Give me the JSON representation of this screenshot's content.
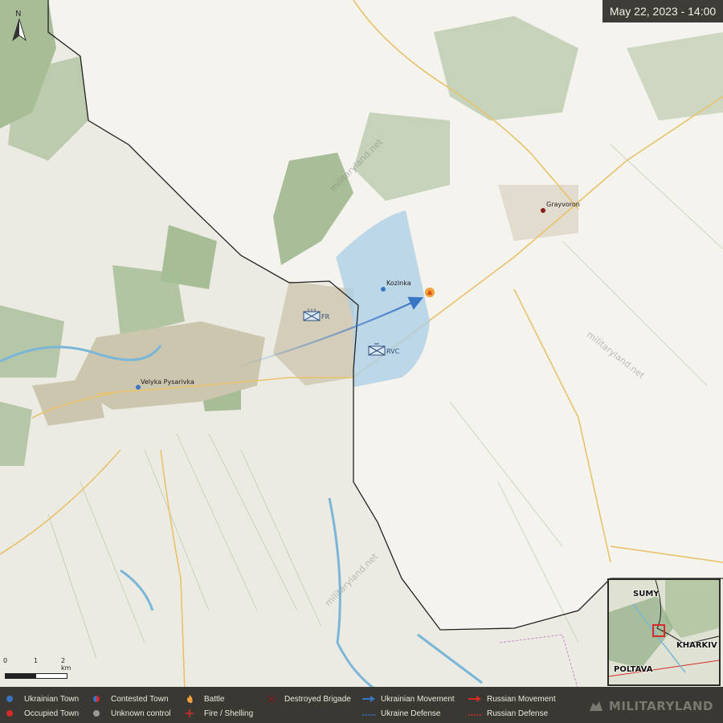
{
  "timestamp": "May 22, 2023 - 14:00",
  "towns": {
    "grayvoron": "Grayvoron",
    "kozinka": "Kozinka",
    "velyka_pysarivka": "Velyka Pysarivka"
  },
  "units": {
    "fr": "FR",
    "rvc": "RVC"
  },
  "watermark": "militaryland.net",
  "scale": {
    "zero": "0",
    "one": "1",
    "two": "2 km"
  },
  "compass": {
    "letter": "N"
  },
  "inset": {
    "sumy": "SUMY",
    "kharkiv": "KHARKIV",
    "poltava": "POLTAVA"
  },
  "legend": {
    "ukrainian_town": "Ukrainian Town",
    "occupied_town": "Occupied Town",
    "contested_town": "Contested Town",
    "unknown_control": "Unknown control",
    "battle": "Battle",
    "fire_shelling": "Fire / Shelling",
    "destroyed_brigade": "Destroyed Brigade",
    "ukrainian_movement": "Ukrainian Movement",
    "ukraine_defense": "Ukraine Defense",
    "russian_movement": "Russian Movement",
    "russian_defense": "Russian Defense"
  },
  "brand": "MILITARYLAND",
  "colors": {
    "ukraine_blue": "#3a75c4",
    "russia_red": "#d42a2a",
    "forest": "#9fb88e",
    "urban": "#cdc6ae",
    "land": "#ecebe3",
    "russia_land": "#f4f3ee",
    "water": "#7ab6d8",
    "control_zone": "#a9cde6"
  }
}
